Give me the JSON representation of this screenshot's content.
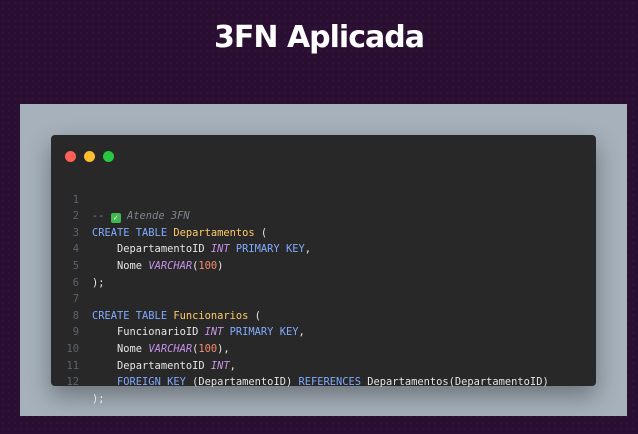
{
  "title": "3FN Aplicada",
  "check_icon": "check-mark-button-icon",
  "colors": {
    "keyword": "#82aaff",
    "table": "#ffcb6b",
    "type": "#c792ea",
    "number": "#f78c6c"
  },
  "code": {
    "line_numbers": [
      "1",
      "2",
      "3",
      "4",
      "5",
      "6",
      "7",
      "8",
      "9",
      "10",
      "11",
      "12"
    ],
    "l1_comment_prefix": "-- ",
    "l1_comment_text": " Atende 3FN",
    "l2_kw": "CREATE TABLE",
    "l2_table": "Departamentos",
    "l2_rest": " (",
    "l3_col": "    DepartamentoID ",
    "l3_type": "INT",
    "l3_kw": " PRIMARY KEY",
    "l3_rest": ",",
    "l4_col": "    Nome ",
    "l4_type": "VARCHAR",
    "l4_paren_open": "(",
    "l4_num": "100",
    "l4_rest": ")",
    "l5": ");",
    "l7_kw": "CREATE TABLE",
    "l7_table": "Funcionarios",
    "l7_rest": " (",
    "l8_col": "    FuncionarioID ",
    "l8_type": "INT",
    "l8_kw": " PRIMARY KEY",
    "l8_rest": ",",
    "l9_col": "    Nome ",
    "l9_type": "VARCHAR",
    "l9_paren_open": "(",
    "l9_num": "100",
    "l9_rest": "),",
    "l10_col": "    DepartamentoID ",
    "l10_type": "INT",
    "l10_rest": ",",
    "l11_indent": "    ",
    "l11_kw1": "FOREIGN KEY",
    "l11_mid": " (DepartamentoID) ",
    "l11_kw2": "REFERENCES",
    "l11_rest": " Departamentos(DepartamentoID)",
    "l12": ");"
  }
}
